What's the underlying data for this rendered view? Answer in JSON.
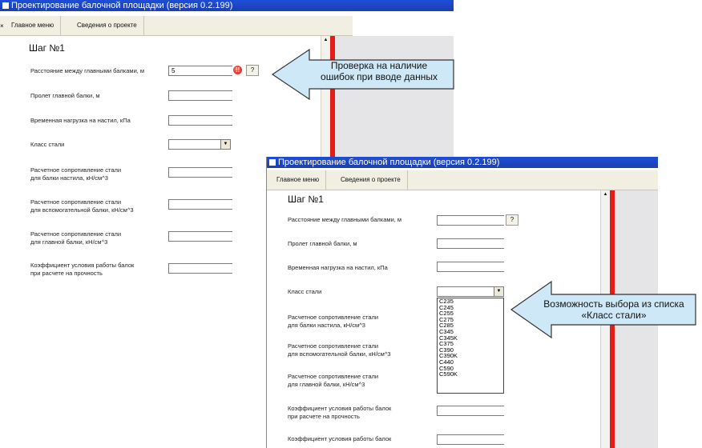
{
  "window1": {
    "title": "Проектирование балочной площадки (версия 0.2.199)",
    "menu": [
      "Главное меню",
      "Сведения о проекте"
    ],
    "step": "Шаг №1",
    "fields": {
      "distance_main": "Расстояние между главными балками, м",
      "distance_value": "5",
      "span_main": "Пролет главной балки, м",
      "temp_load": "Временная нагрузка на настил, кПа",
      "steel_class": "Класс стали",
      "resist_deck": "Расчетное сопротивление стали\nдля балки настила, кН/см^3",
      "resist_aux": "Расчетное сопротивление стали\nдля вспомогательной балки, кН/см^3",
      "resist_main": "Расчетное сопротивление стали\nдля главной балки, кН/см^3",
      "coef_strength": "Коэффициент условия работы балок\nпри расчете на прочность"
    },
    "help_label": "?",
    "error_icon_label": "!!"
  },
  "window2": {
    "title": "Проектирование балочной площадки (версия 0.2.199)",
    "menu": [
      "Главное меню",
      "Сведения о проекте"
    ],
    "step": "Шаг №1",
    "fields": {
      "distance_main": "Расстояние между главными балками, м",
      "span_main": "Пролет главной балки, м",
      "temp_load": "Временная нагрузка на настил, кПа",
      "steel_class": "Класс стали",
      "resist_deck": "Расчетное сопротивление стали\nдля балки настила, кН/см^3",
      "resist_aux": "Расчетное сопротивление стали\nдля вспомогательной балки, кН/см^3",
      "resist_main": "Расчетное сопротивление стали\nдля главной балки, кН/см^3",
      "coef_strength": "Коэффициент условия работы балок\nпри расчете на прочность",
      "coef_strength2": "Коэффициент условия работы балок"
    },
    "help_label": "?",
    "steel_options": [
      "C235",
      "C245",
      "C255",
      "C275",
      "C285",
      "C345",
      "C345K",
      "C375",
      "C390",
      "C390K",
      "C440",
      "C590",
      "C590K"
    ]
  },
  "callouts": {
    "errors": "Проверка на наличие\nошибок при вводе данных",
    "list": "Возможность выбора из списка\n«Класс стали»"
  },
  "colors": {
    "accent_red": "#e81c17",
    "title_blue": "#1e40af",
    "callout_fill": "#cfe8f7"
  },
  "icons": {
    "dropdown_arrow": "▼",
    "scroll_up": "▲"
  }
}
